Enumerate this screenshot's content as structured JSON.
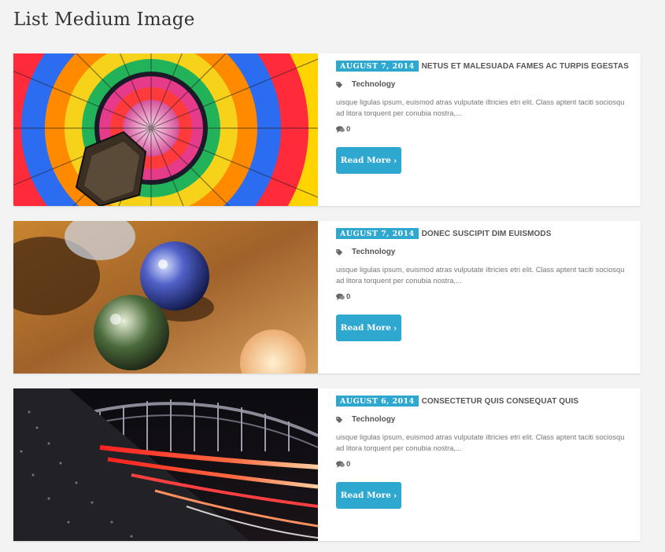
{
  "page": {
    "title": "List Medium Image"
  },
  "posts": [
    {
      "date": "AUGUST 7, 2014",
      "title": "NETUS ET MALESUADA FAMES AC TURPIS EGESTAS",
      "category": "Technology",
      "excerpt": "uisque ligulas ipsum, euismod atras vulputate iltricies etri elit. Class aptent taciti sociosqu ad litora torquent per conubia nostra,...",
      "comments": "0",
      "read_more": "Read More",
      "image": "colorful hot air balloon"
    },
    {
      "date": "AUGUST 7, 2014",
      "title": "DONEC SUSCIPIT DIM EUISMODS",
      "category": "Technology",
      "excerpt": "uisque ligulas ipsum, euismod atras vulputate iltricies etri elit. Class aptent taciti sociosqu ad litora torquent per conubia nostra,...",
      "comments": "0",
      "read_more": "Read More",
      "image": "glass marbles"
    },
    {
      "date": "AUGUST 6, 2014",
      "title": "CONSECTETUR QUIS CONSEQUAT QUIS",
      "category": "Technology",
      "excerpt": "uisque ligulas ipsum, euismod atras vulputate iltricies etri elit. Class aptent taciti sociosqu ad litora torquent per conubia nostra,...",
      "comments": "0",
      "read_more": "Read More",
      "image": "bridge with light trails at night"
    }
  ],
  "colors": {
    "accent": "#2ea8cf",
    "background": "#f3f3f3",
    "card": "#ffffff"
  },
  "icons": {
    "tag": "tag-icon",
    "comment": "comment-icon",
    "chevron": "chevron-right-icon"
  }
}
